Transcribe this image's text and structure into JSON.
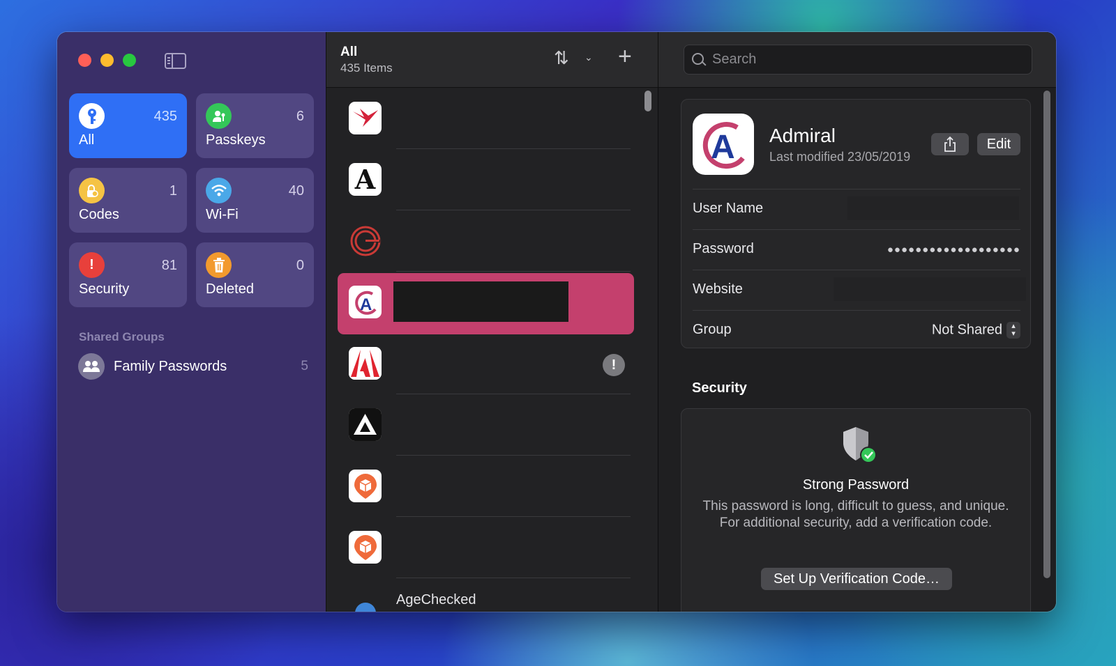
{
  "sidebar": {
    "tiles": [
      {
        "label": "All",
        "count": "435",
        "icon": "key-icon",
        "color": "#2f6ff5"
      },
      {
        "label": "Passkeys",
        "count": "6",
        "icon": "person-key-icon",
        "color": "#34c759"
      },
      {
        "label": "Codes",
        "count": "1",
        "icon": "lock-clock-icon",
        "color": "#f5c344"
      },
      {
        "label": "Wi-Fi",
        "count": "40",
        "icon": "wifi-icon",
        "color": "#4aa8e8"
      },
      {
        "label": "Security",
        "count": "81",
        "icon": "exclamation-icon",
        "color": "#e8403b"
      },
      {
        "label": "Deleted",
        "count": "0",
        "icon": "trash-icon",
        "color": "#f29a2e"
      }
    ],
    "shared_groups_title": "Shared Groups",
    "family": {
      "name": "Family Passwords",
      "count": "5"
    }
  },
  "list": {
    "title": "All",
    "subtitle": "435 Items",
    "partial_item": "AgeChecked"
  },
  "search": {
    "placeholder": "Search"
  },
  "detail": {
    "name": "Admiral",
    "modified": "Last modified 23/05/2019",
    "edit_label": "Edit",
    "fields": {
      "username_label": "User Name",
      "password_label": "Password",
      "password_value": "●●●●●●●●●●●●●●●●●●●",
      "website_label": "Website",
      "group_label": "Group",
      "group_value": "Not Shared"
    },
    "security": {
      "title": "Security",
      "status": "Strong Password",
      "description": "This password is long, difficult to guess, and unique. For additional security, add a verification code.",
      "button": "Set Up Verification Code…"
    }
  }
}
